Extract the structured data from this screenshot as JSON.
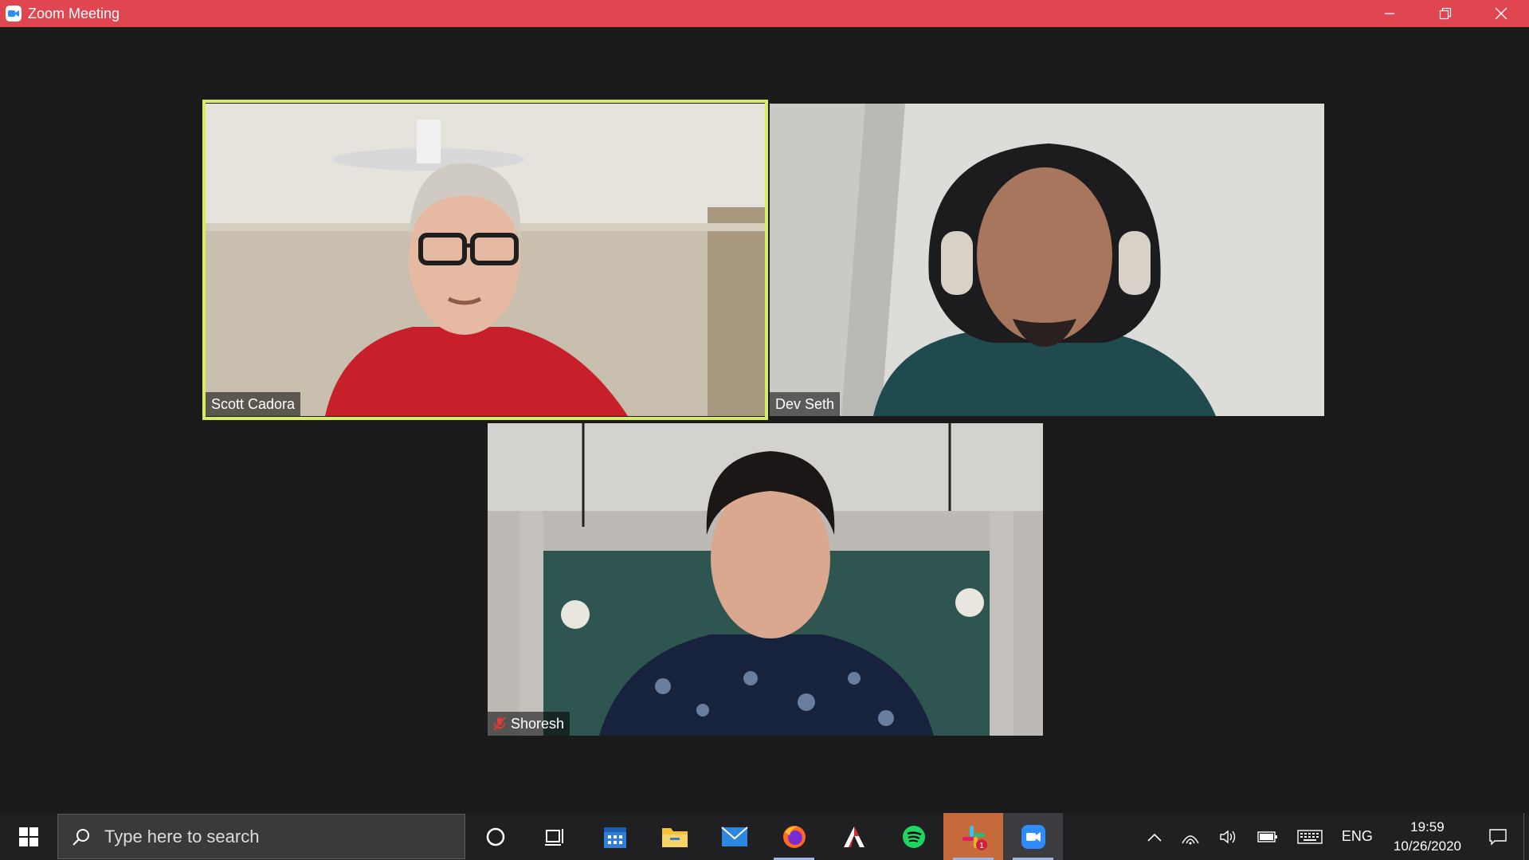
{
  "window": {
    "title": "Zoom Meeting",
    "icon": "zoom-camera-icon",
    "controls": [
      "minimize-icon",
      "restore-icon",
      "close-icon"
    ],
    "accent": "#e0464f"
  },
  "meeting": {
    "active_speaker_color": "#d7ec5f",
    "participants": [
      {
        "name": "Scott Cadora",
        "active_speaker": true,
        "muted": false
      },
      {
        "name": "Dev Seth",
        "active_speaker": false,
        "muted": false
      },
      {
        "name": "Shoresh",
        "active_speaker": false,
        "muted": true
      }
    ]
  },
  "taskbar": {
    "search_placeholder": "Type here to search",
    "apps": [
      {
        "icon": "cortana-circle-icon"
      },
      {
        "icon": "task-view-icon"
      },
      {
        "icon": "calendar-icon"
      },
      {
        "icon": "file-explorer-icon"
      },
      {
        "icon": "mail-icon"
      },
      {
        "icon": "firefox-icon"
      },
      {
        "icon": "acrobat-icon"
      },
      {
        "icon": "spotify-icon"
      },
      {
        "icon": "slack-icon",
        "badge": "1"
      },
      {
        "icon": "zoom-icon"
      }
    ],
    "tray": {
      "language": "ENG",
      "time": "19:59",
      "date": "10/26/2020"
    }
  }
}
